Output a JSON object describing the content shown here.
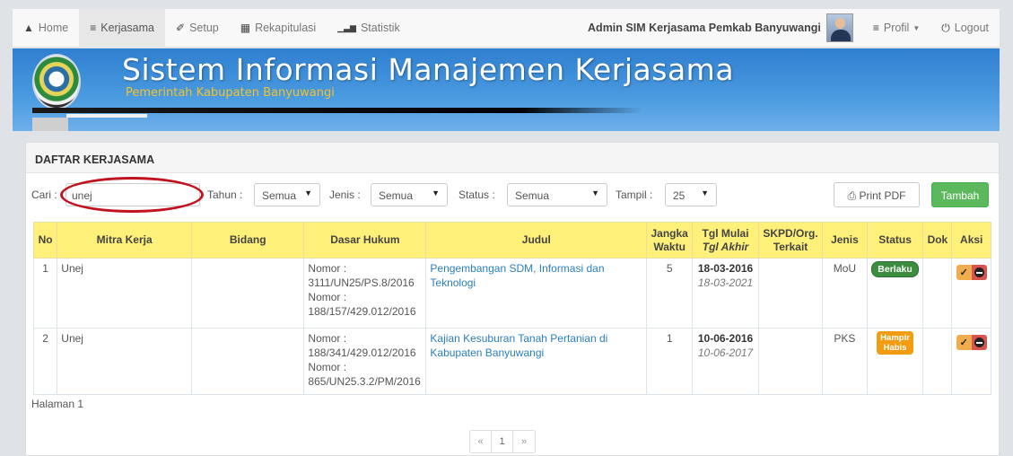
{
  "nav": {
    "items": [
      {
        "label": "Home",
        "icon": "home-icon",
        "glyph": "⌂"
      },
      {
        "label": "Kerjasama",
        "icon": "list-icon",
        "glyph": "≡"
      },
      {
        "label": "Setup",
        "icon": "wrench-icon",
        "glyph": "✎"
      },
      {
        "label": "Rekapitulasi",
        "icon": "table-icon",
        "glyph": "▦"
      },
      {
        "label": "Statistik",
        "icon": "bar-chart-icon",
        "glyph": "▁▃▆"
      }
    ],
    "user_name": "Admin SIM Kerjasama Pemkab Banyuwangi",
    "profil_label": "Profil",
    "logout_label": "Logout"
  },
  "banner": {
    "title": "Sistem Informasi Manajemen Kerjasama",
    "subtitle": "Pemerintah Kabupaten Banyuwangi"
  },
  "panel": {
    "title": "DAFTAR KERJASAMA"
  },
  "filters": {
    "cari_label": "Cari :",
    "cari_value": "unej",
    "tahun_label": "Tahun :",
    "tahun_value": "Semua",
    "jenis_label": "Jenis :",
    "jenis_value": "Semua",
    "status_label": "Status :",
    "status_value": "Semua",
    "tampil_label": "Tampil :",
    "tampil_value": "25",
    "print_label": "Print PDF",
    "add_label": "Tambah"
  },
  "table": {
    "headers": {
      "no": "No",
      "mitra": "Mitra Kerja",
      "bidang": "Bidang",
      "dasar": "Dasar Hukum",
      "judul": "Judul",
      "jangka1": "Jangka",
      "jangka2": "Waktu",
      "tgl1": "Tgl Mulai",
      "tgl2": "Tgl Akhir",
      "skpd1": "SKPD/Org.",
      "skpd2": "Terkait",
      "jenis": "Jenis",
      "status": "Status",
      "dok": "Dok",
      "aksi": "Aksi"
    },
    "rows": [
      {
        "no": "1",
        "mitra": "Unej",
        "bidang": "",
        "dasar": [
          "Nomor :",
          "3111/UN25/PS.8/2016",
          "Nomor :",
          "188/157/429.012/2016"
        ],
        "judul": "Pengembangan SDM, Informasi dan Teknologi",
        "jangka": "5",
        "tgl_mulai": "18-03-2016",
        "tgl_akhir": "18-03-2021",
        "skpd": "",
        "jenis": "MoU",
        "status": "Berlaku",
        "status_color": "#3c8d3f"
      },
      {
        "no": "2",
        "mitra": "Unej",
        "bidang": "",
        "dasar": [
          "Nomor :",
          "188/341/429.012/2016",
          "Nomor :",
          "865/UN25.3.2/PM/2016"
        ],
        "judul": "Kajian Kesuburan Tanah Pertanian di Kabupaten Banyuwangi",
        "jangka": "1",
        "tgl_mulai": "10-06-2016",
        "tgl_akhir": "10-06-2017",
        "skpd": "",
        "jenis": "PKS",
        "status_line1": "Hampir",
        "status_line2": "Habis",
        "status_color": "#f39c12"
      }
    ]
  },
  "footer": {
    "halaman": "Halaman 1",
    "pager_prev": "«",
    "pager_page": "1",
    "pager_next": "»"
  }
}
